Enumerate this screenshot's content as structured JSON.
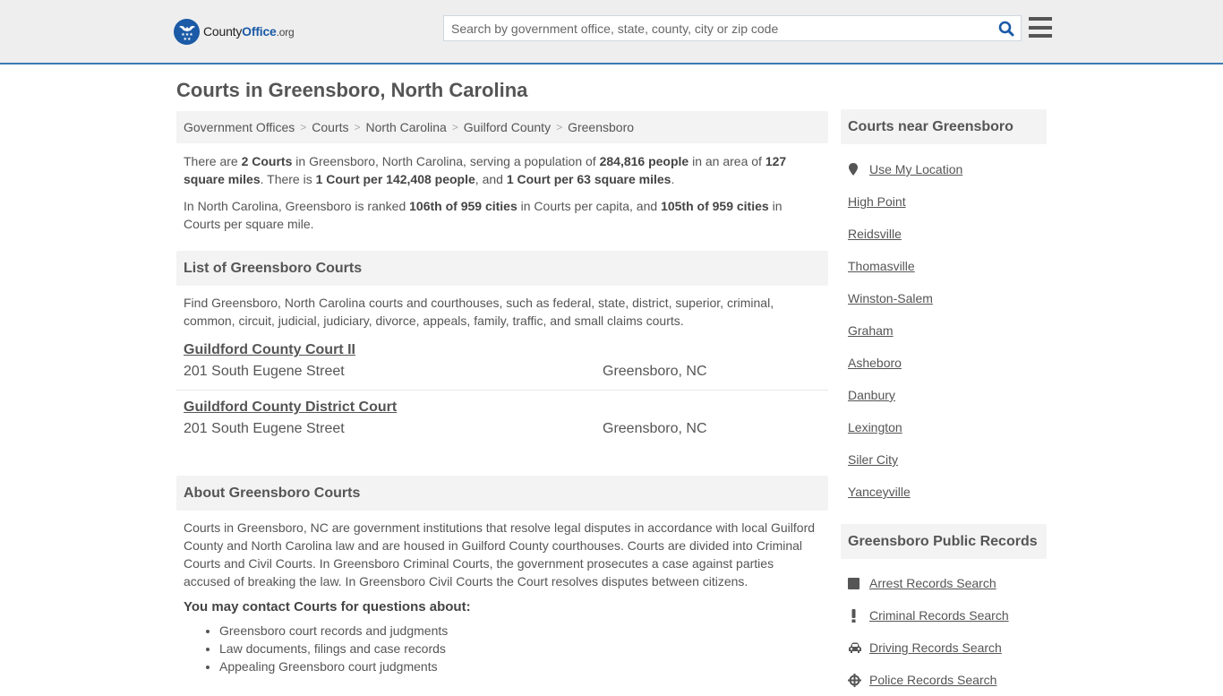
{
  "header": {
    "logo": {
      "county": "County",
      "office": "Office",
      "org": ".org"
    },
    "search_placeholder": "Search by government office, state, county, city or zip code",
    "search_value": ""
  },
  "page_title": "Courts in Greensboro, North Carolina",
  "breadcrumb": [
    "Government Offices",
    "Courts",
    "North Carolina",
    "Guilford County",
    "Greensboro"
  ],
  "summary": {
    "p1": {
      "t1": "There are ",
      "b1": "2 Courts",
      "t2": " in Greensboro, North Carolina, serving a population of ",
      "b2": "284,816 people",
      "t3": " in an area of ",
      "b3": "127 square miles",
      "t4": ". There is ",
      "b4": "1 Court per 142,408 people",
      "t5": ", and ",
      "b5": "1 Court per 63 square miles",
      "t6": "."
    },
    "p2": {
      "t1": "In North Carolina, Greensboro is ranked ",
      "b1": "106th of 959 cities",
      "t2": " in Courts per capita, and ",
      "b2": "105th of 959 cities",
      "t3": " in Courts per square mile."
    }
  },
  "list_section": {
    "title": "List of Greensboro Courts",
    "intro": "Find Greensboro, North Carolina courts and courthouses, such as federal, state, district, superior, criminal, common, circuit, judicial, judiciary, divorce, appeals, family, traffic, and small claims courts.",
    "courts": [
      {
        "name": "Guildford County Court II",
        "address": "201 South Eugene Street",
        "city": "Greensboro, NC"
      },
      {
        "name": "Guildford County District Court",
        "address": "201 South Eugene Street",
        "city": "Greensboro, NC"
      }
    ]
  },
  "about_section": {
    "title": "About Greensboro Courts",
    "body": "Courts in Greensboro, NC are government institutions that resolve legal disputes in accordance with local Guilford County and North Carolina law and are housed in Guilford County courthouses. Courts are divided into Criminal Courts and Civil Courts. In Greensboro Criminal Courts, the government prosecutes a case against parties accused of breaking the law. In Greensboro Civil Courts the Court resolves disputes between citizens.",
    "contact_heading": "You may contact Courts for questions about:",
    "topics": [
      "Greensboro court records and judgments",
      "Law documents, filings and case records",
      "Appealing Greensboro court judgments"
    ]
  },
  "sidebar": {
    "nearby_title": "Courts near Greensboro",
    "use_location": "Use My Location",
    "nearby": [
      "High Point",
      "Reidsville",
      "Thomasville",
      "Winston-Salem",
      "Graham",
      "Asheboro",
      "Danbury",
      "Lexington",
      "Siler City",
      "Yanceyville"
    ],
    "records_title": "Greensboro Public Records",
    "records": [
      {
        "label": "Arrest Records Search",
        "icon": "square-icon"
      },
      {
        "label": "Criminal Records Search",
        "icon": "exclamation-icon"
      },
      {
        "label": "Driving Records Search",
        "icon": "car-icon"
      },
      {
        "label": "Police Records Search",
        "icon": "crosshair-icon"
      }
    ]
  },
  "colors": {
    "brand_blue": "#1a5aa6",
    "header_border": "#3a7ab5",
    "text": "#555555",
    "panel_bg": "#f3f3f3"
  }
}
